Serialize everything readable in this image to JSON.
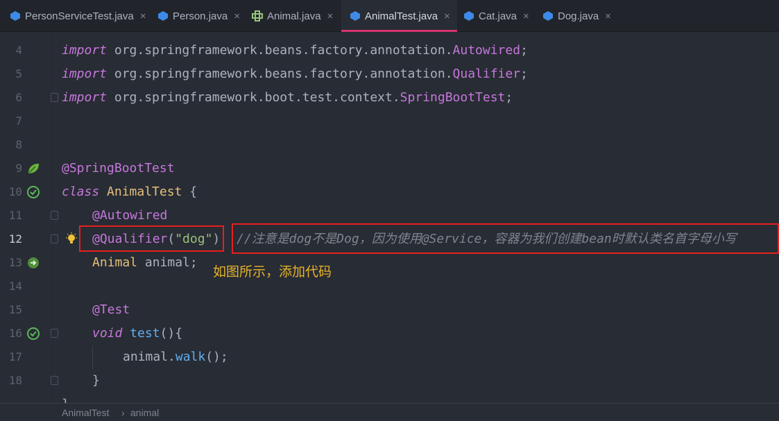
{
  "tabs": [
    {
      "label": "PersonServiceTest.java",
      "icon": "java-class-icon",
      "active": false
    },
    {
      "label": "Person.java",
      "icon": "java-class-icon",
      "active": false
    },
    {
      "label": "Animal.java",
      "icon": "java-interface-icon",
      "active": false
    },
    {
      "label": "AnimalTest.java",
      "icon": "java-class-icon",
      "active": true
    },
    {
      "label": "Cat.java",
      "icon": "java-class-icon",
      "active": false
    },
    {
      "label": "Dog.java",
      "icon": "java-class-icon",
      "active": false
    }
  ],
  "close_glyph": "×",
  "line_numbers": [
    "4",
    "5",
    "6",
    "7",
    "8",
    "9",
    "10",
    "11",
    "12",
    "13",
    "14",
    "15",
    "16",
    "17",
    "18"
  ],
  "code": {
    "l4": {
      "kw": "import",
      "pkg": " org.springframework.beans.factory.annotation.",
      "cls": "Autowired",
      "end": ";"
    },
    "l5": {
      "kw": "import",
      "pkg": " org.springframework.beans.factory.annotation.",
      "cls": "Qualifier",
      "end": ";"
    },
    "l6": {
      "kw": "import",
      "pkg": " org.springframework.boot.test.context.",
      "cls": "SpringBootTest",
      "end": ";"
    },
    "l9": {
      "ann": "@SpringBootTest"
    },
    "l10": {
      "kw": "class",
      "name": " AnimalTest ",
      "brace": "{"
    },
    "l11": {
      "ann": "@Autowired"
    },
    "l12": {
      "ann": "@Qualifier",
      "open": "(",
      "str": "\"dog\"",
      "close": ")",
      "comment": "//注意是dog不是Dog，因为使用@Service，容器为我们创建bean时默认类名首字母小写"
    },
    "l13": {
      "type": "Animal",
      "var": " animal;"
    },
    "l15": {
      "ann": "@Test"
    },
    "l16": {
      "kw": "void",
      "fn": " test",
      "rest": "(){"
    },
    "l17": {
      "obj": "animal.",
      "fn": "walk",
      "rest": "();"
    },
    "l18": {
      "brace": "}"
    },
    "l19": {
      "brace": "}"
    }
  },
  "annotation_note": "如图所示，添加代码",
  "breadcrumb": {
    "class": "AnimalTest",
    "sep": "›",
    "member": "animal"
  },
  "colors": {
    "accent_tab": "#d6336c",
    "highlight_box": "#e81f1f",
    "note": "#e5b32b"
  }
}
